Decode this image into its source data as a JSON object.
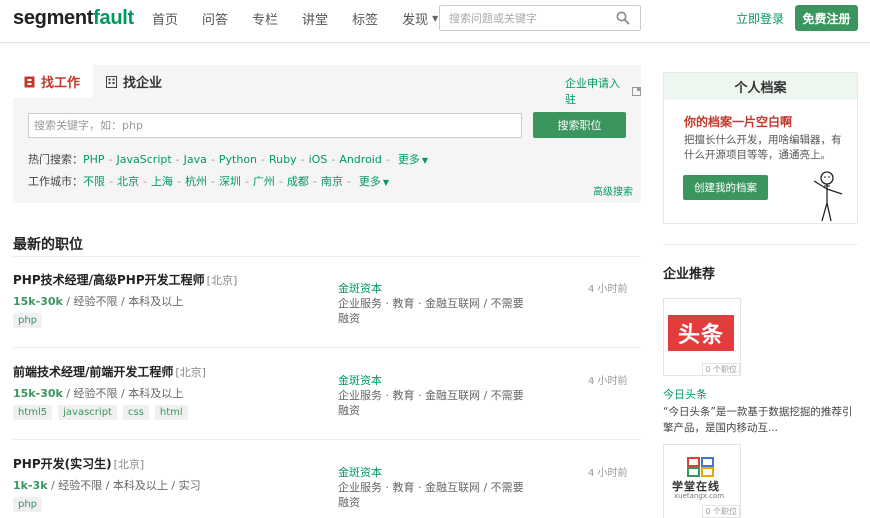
{
  "header": {
    "logo_main": "segment",
    "logo_accent": "fault",
    "nav": [
      "首页",
      "问答",
      "专栏",
      "讲堂",
      "标签",
      "发现"
    ],
    "search_placeholder": "搜索问题或关键字",
    "login": "立即登录",
    "register": "免费注册"
  },
  "jobsearch": {
    "tabs": [
      "找工作",
      "找企业"
    ],
    "company_entry": "企业申请入驻",
    "keyword_placeholder": "搜索关键字，如：php",
    "search_button": "搜索职位",
    "hot_label": "热门搜索：",
    "hot_options": [
      "PHP",
      "JavaScript",
      "Java",
      "Python",
      "Ruby",
      "iOS",
      "Android"
    ],
    "city_label": "工作城市：",
    "city_options": [
      "不限",
      "北京",
      "上海",
      "杭州",
      "深圳",
      "广州",
      "成都",
      "南京"
    ],
    "more": "更多",
    "advanced": "高级搜索"
  },
  "latest": {
    "title": "最新的职位",
    "jobs": [
      {
        "title": "PHP技术经理/高级PHP开发工程师",
        "location": "[北京]",
        "salary": "15k-30k",
        "req": " / 经验不限 / 本科及以上",
        "tags": [
          "php"
        ],
        "company": "金斑资本",
        "industry": "企业服务 · 教育 · 金融互联网 / 不需要融资",
        "time": "4 小时前"
      },
      {
        "title": "前端技术经理/前端开发工程师",
        "location": "[北京]",
        "salary": "15k-30k",
        "req": " / 经验不限 / 本科及以上",
        "tags": [
          "html5",
          "javascript",
          "css",
          "html"
        ],
        "company": "金斑资本",
        "industry": "企业服务 · 教育 · 金融互联网 / 不需要融资",
        "time": "4 小时前"
      },
      {
        "title": "PHP开发(实习生)",
        "location": "[北京]",
        "salary": "1k-3k",
        "req": " / 经验不限 / 本科及以上 / 实习",
        "tags": [
          "php"
        ],
        "company": "金斑资本",
        "industry": "企业服务 · 教育 · 金融互联网 / 不需要融资",
        "time": "4 小时前"
      }
    ]
  },
  "profile": {
    "header": "个人档案",
    "title": "你的档案一片空白啊",
    "desc": "把擅长什么开发，用啥编辑器，有什么开源项目等等，通通亮上。",
    "button": "创建我的档案"
  },
  "recommend": {
    "title": "企业推荐",
    "companies": [
      {
        "logo_text": "头条",
        "count": "0 个职位",
        "name": "今日头条",
        "desc": "“今日头条”是一款基于数据挖掘的推荐引擎产品，是国内移动互..."
      },
      {
        "logo_text": "学堂在线",
        "logo_sub": "xuetangx.com",
        "count": "0 个职位"
      }
    ]
  },
  "colors": {
    "accent": "#009a61",
    "button": "#3a965e",
    "alert": "#c0392b",
    "toutiao": "#e23c3c"
  }
}
